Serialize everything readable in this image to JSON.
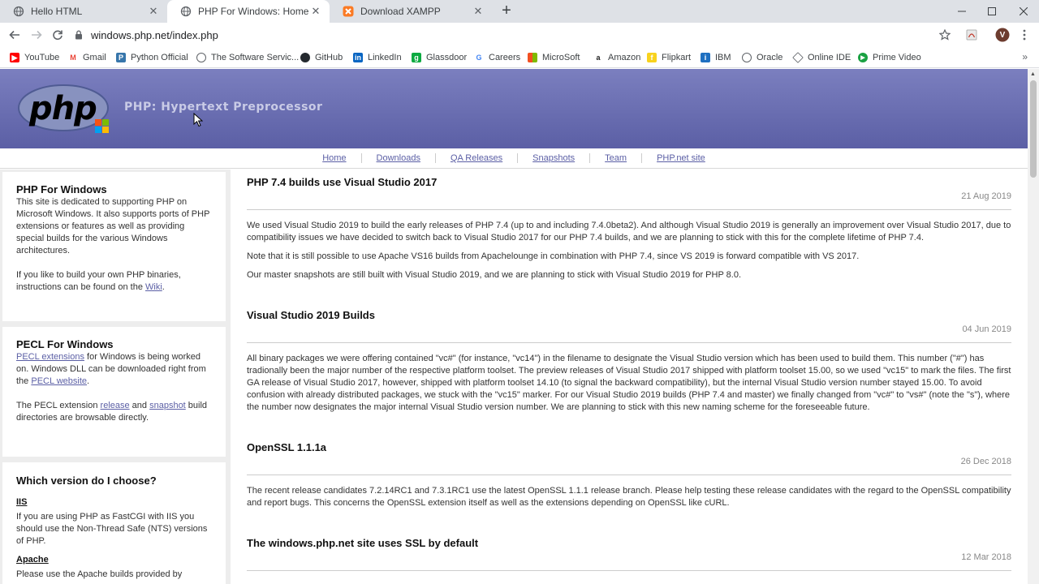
{
  "browser": {
    "tabs": [
      {
        "title": "Hello HTML"
      },
      {
        "title": "PHP For Windows: Home"
      },
      {
        "title": "Download XAMPP"
      }
    ],
    "url": "windows.php.net/index.php",
    "profile_initial": "V",
    "bookmarks": [
      {
        "label": "YouTube",
        "icon": "youtube-icon",
        "color": "#ff0000"
      },
      {
        "label": "Gmail",
        "icon": "gmail-icon",
        "color": "#ea4335"
      },
      {
        "label": "Python Official",
        "icon": "python-icon",
        "color": "#3776ab"
      },
      {
        "label": "The Software Servic...",
        "icon": "globe-icon",
        "color": "#5f6368"
      },
      {
        "label": "GitHub",
        "icon": "github-icon",
        "color": "#24292e"
      },
      {
        "label": "LinkedIn",
        "icon": "linkedin-icon",
        "color": "#0a66c2"
      },
      {
        "label": "Glassdoor",
        "icon": "glassdoor-icon",
        "color": "#0caa41"
      },
      {
        "label": "Careers",
        "icon": "google-icon",
        "color": "#4285f4"
      },
      {
        "label": "MicroSoft",
        "icon": "microsoft-icon",
        "color": "#f25022"
      },
      {
        "label": "Amazon",
        "icon": "amazon-icon",
        "color": "#222222"
      },
      {
        "label": "Flipkart",
        "icon": "flipkart-icon",
        "color": "#f8d21d"
      },
      {
        "label": "IBM",
        "icon": "ibm-icon",
        "color": "#1f70c1"
      },
      {
        "label": "Oracle",
        "icon": "globe-icon",
        "color": "#5f6368"
      },
      {
        "label": "Online IDE",
        "icon": "diamond-icon",
        "color": "#5f6368"
      },
      {
        "label": "Prime Video",
        "icon": "prime-icon",
        "color": "#1aa142"
      }
    ]
  },
  "site": {
    "logo_text": "php",
    "tagline": "PHP: Hypertext Preprocessor",
    "nav": [
      "Home",
      "Downloads",
      "QA Releases",
      "Snapshots",
      "Team",
      "PHP.net site"
    ]
  },
  "sidebar": {
    "box1": {
      "title": "PHP For Windows",
      "p1": "This site is dedicated to supporting PHP on Microsoft Windows. It also supports ports of PHP extensions or features as well as providing special builds for the various Windows architectures.",
      "p2_pre": "If you like to build your own PHP binaries, instructions can be found on the ",
      "p2_link": "Wiki",
      "p2_post": "."
    },
    "box2": {
      "title": "PECL For Windows",
      "link1": "PECL extensions",
      "p1_mid": " for Windows is being worked on. Windows DLL can be downloaded right from the ",
      "link2": "PECL website",
      "p1_post": ".",
      "p2_pre": "The PECL extension ",
      "link3": "release",
      "p2_mid": " and ",
      "link4": "snapshot",
      "p2_post": " build directories are browsable directly."
    },
    "box3": {
      "title": "Which version do I choose?",
      "h_iis": "IIS",
      "p_iis": "If you are using PHP as FastCGI with IIS you should use the Non-Thread Safe (NTS) versions of PHP.",
      "h_apache": "Apache",
      "p_apache": "Please use the Apache builds provided by"
    }
  },
  "posts": [
    {
      "title": "PHP 7.4 builds use Visual Studio 2017",
      "date": "21 Aug 2019",
      "paragraphs": [
        "We used Visual Studio 2019 to build the early releases of PHP 7.4 (up to and including 7.4.0beta2). And although Visual Studio 2019 is generally an improvement over Visual Studio 2017, due to compatibility issues we have decided to switch back to Visual Studio 2017 for our PHP 7.4 builds, and we are planning to stick with this for the complete lifetime of PHP 7.4.",
        "Note that it is still possible to use Apache VS16 builds from Apachelounge in combination with PHP 7.4, since VS 2019 is forward compatible with VS 2017.",
        "Our master snapshots are still built with Visual Studio 2019, and we are planning to stick with Visual Studio 2019 for PHP 8.0."
      ]
    },
    {
      "title": "Visual Studio 2019 Builds",
      "date": "04 Jun 2019",
      "paragraphs": [
        "All binary packages we were offering contained \"vc#\" (for instance, \"vc14\") in the filename to designate the Visual Studio version which has been used to build them. This number (\"#\") has tradionally been the major number of the respective platform toolset. The preview releases of Visual Studio 2017 shipped with platform toolset 15.00, so we used \"vc15\" to mark the files. The first GA release of Visual Studio 2017, however, shipped with platform toolset 14.10 (to signal the backward compatibility), but the internal Visual Studio version number stayed 15.00. To avoid confusion with already distributed packages, we stuck with the \"vc15\" marker. For our Visual Studio 2019 builds (PHP 7.4 and master) we finally changed from \"vc#\" to \"vs#\" (note the \"s\"), where the number now designates the major internal Visual Studio version number. We are planning to stick with this new naming scheme for the foreseeable future."
      ]
    },
    {
      "title": "OpenSSL 1.1.1a",
      "date": "26 Dec 2018",
      "paragraphs": [
        "The recent release candidates 7.2.14RC1 and 7.3.1RC1 use the latest OpenSSL 1.1.1 release branch. Please help testing these release candidates with the regard to the OpenSSL compatibility and report bugs. This concerns the OpenSSL extension itself as well as the extensions depending on OpenSSL like cURL."
      ]
    },
    {
      "title": "The windows.php.net site uses SSL by default",
      "date": "12 Mar 2018",
      "paragraphs": []
    }
  ]
}
